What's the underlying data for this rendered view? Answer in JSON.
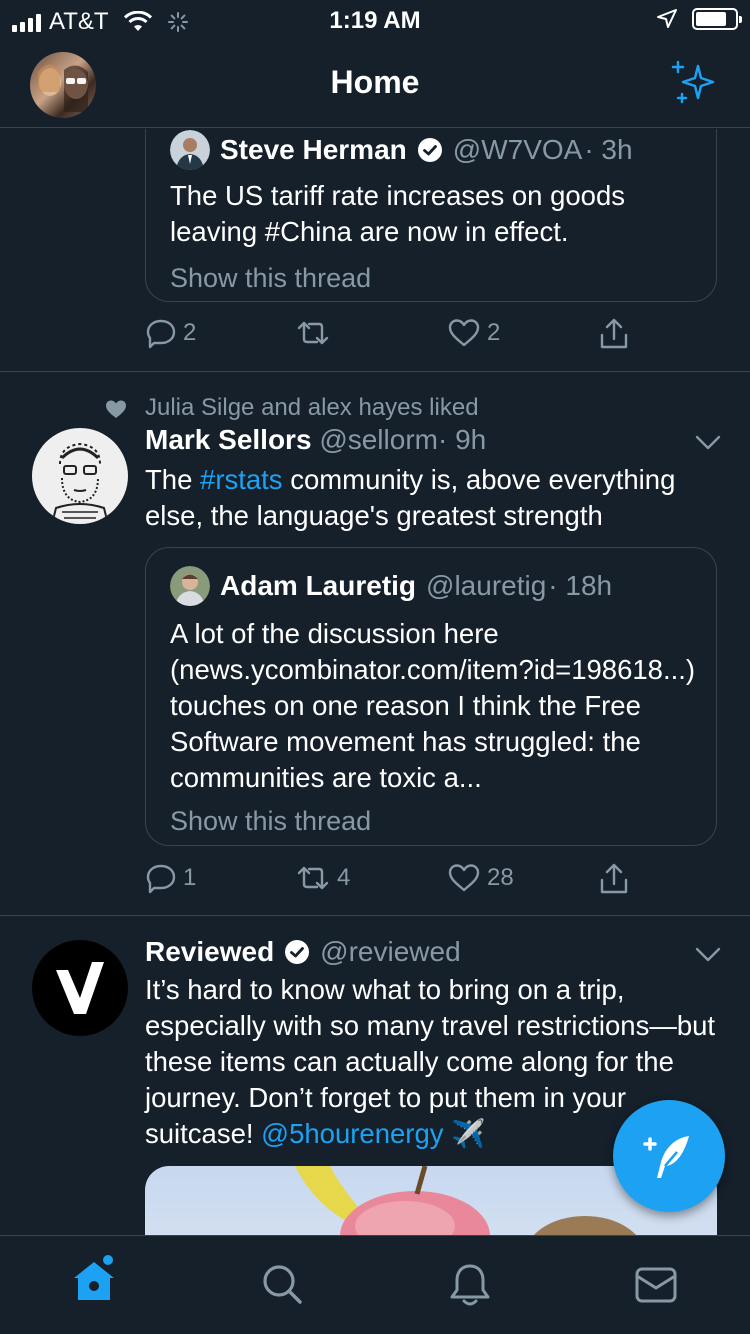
{
  "status_bar": {
    "carrier": "AT&T",
    "time": "1:19 AM"
  },
  "header": {
    "title": "Home"
  },
  "tweets": [
    {
      "quote": {
        "name": "Steve Herman",
        "handle": "@W7VOA",
        "time": "· 3h",
        "text": "The US tariff rate increases on goods leaving #China are now in effect.",
        "show_thread": "Show this thread"
      },
      "actions": {
        "replies": "2",
        "retweets": "",
        "likes": "2"
      }
    },
    {
      "social_context": "Julia Silge and alex hayes liked",
      "name": "Mark Sellors",
      "handle": "@sellorm",
      "time": "· 9h",
      "text_before": "The ",
      "hashtag": "#rstats",
      "text_after": " community is, above everything else, the language's greatest strength",
      "quote": {
        "name": "Adam Lauretig",
        "handle": "@lauretig",
        "time": "· 18h",
        "text": "A lot of the discussion here (news.ycombinator.com/item?id=198618...) touches on one reason I think the Free Software movement has struggled: the communities are toxic a...",
        "show_thread": "Show this thread"
      },
      "actions": {
        "replies": "1",
        "retweets": "4",
        "likes": "28"
      }
    },
    {
      "name": "Reviewed",
      "handle": "@reviewed",
      "text_before": "It’s hard to know what to bring on a trip, especially with so many travel restrictions—but these items can actually come along for the journey. Don’t forget to put them in your suitcase! ",
      "mention": "@5hourenergy",
      "emoji": "✈️"
    }
  ],
  "colors": {
    "background": "#15202b",
    "accent": "#1da1f2",
    "muted": "#8899a6",
    "border": "#38444d"
  },
  "tabbar": {
    "tabs": [
      "home-icon",
      "search-icon",
      "notifications-icon",
      "messages-icon"
    ]
  }
}
